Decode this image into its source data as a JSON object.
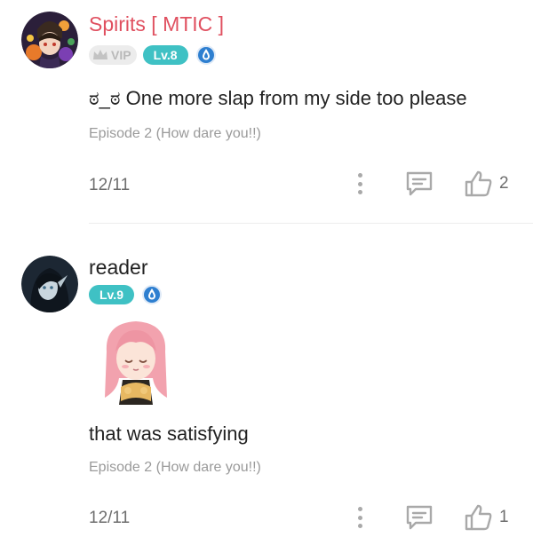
{
  "comments": [
    {
      "username": "Spirits [ MTIC ]",
      "badges": {
        "vip_label": "VIP",
        "level_label": "Lv.8"
      },
      "text": "ಠ_ಠ One more slap from my side too please",
      "episode": "Episode 2 (How dare you!!)",
      "date": "12/11",
      "likes": "2"
    },
    {
      "username": "reader",
      "badges": {
        "level_label": "Lv.9"
      },
      "text": "that was satisfying",
      "episode": "Episode 2 (How dare you!!)",
      "date": "12/11",
      "likes": "1"
    }
  ],
  "colors": {
    "username_highlight": "#e05060",
    "level_badge": "#3fc1c4",
    "verify_badge": "#2e7fd0",
    "meta_text": "#9a9a9a",
    "icon_gray": "#a9a9a9"
  },
  "icons": {
    "more": "vertical-dots-icon",
    "reply": "comment-bubble-icon",
    "like": "thumbs-up-icon",
    "verify": "verified-drop-icon",
    "vip": "crown-icon"
  }
}
